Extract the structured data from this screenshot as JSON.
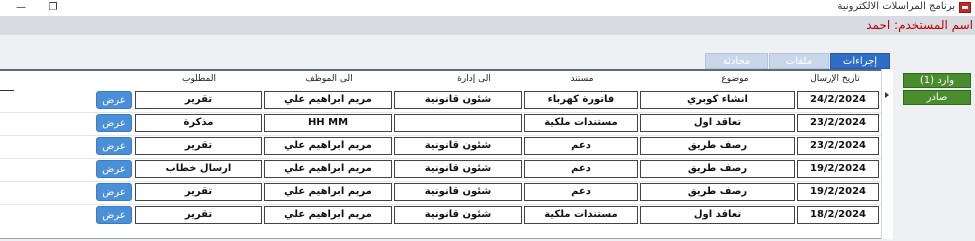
{
  "window": {
    "title": "برنامج المراسلات الالكترونية",
    "minimize_glyph": "—",
    "maximize_glyph": "❐"
  },
  "user": {
    "label": "اسم المستخدم: احمد"
  },
  "tabs": [
    {
      "label": "إجراءات",
      "active": true
    },
    {
      "label": "ملفات",
      "active": false
    },
    {
      "label": "محادثة",
      "active": false
    }
  ],
  "sidenav": {
    "inbox": "وارد (1)",
    "outbox": "صادر"
  },
  "table": {
    "headers": {
      "date": "تاريخ الإرسال",
      "subject": "موضوع",
      "document": "مستند",
      "to_department": "الى إدارة",
      "to_employee": "الى الموظف",
      "required": "المطلوب"
    },
    "view_label": "عرض",
    "rows": [
      {
        "date": "24/2/2024",
        "subject": "انشاء كوبري",
        "document": "فاتورة كهرباء",
        "to_department": "شئون قانونية",
        "to_employee": "مريم ابراهيم علي",
        "required": "تقرير"
      },
      {
        "date": "23/2/2024",
        "subject": "تعاقد اول",
        "document": "مستندات ملكية",
        "to_department": "",
        "to_employee": "HH MM",
        "required": "مذكرة"
      },
      {
        "date": "23/2/2024",
        "subject": "رصف طريق",
        "document": "دعم",
        "to_department": "شئون قانونية",
        "to_employee": "مريم ابراهيم علي",
        "required": "تقرير"
      },
      {
        "date": "19/2/2024",
        "subject": "رصف طريق",
        "document": "دعم",
        "to_department": "شئون قانونية",
        "to_employee": "مريم ابراهيم علي",
        "required": "ارسال خطاب"
      },
      {
        "date": "19/2/2024",
        "subject": "رصف طريق",
        "document": "دعم",
        "to_department": "شئون قانونية",
        "to_employee": "مريم ابراهيم علي",
        "required": "تقرير"
      },
      {
        "date": "18/2/2024",
        "subject": "تعاقد اول",
        "document": "مستندات ملكية",
        "to_department": "شئون قانونية",
        "to_employee": "مريم ابراهيم علي",
        "required": "تقرير"
      }
    ]
  }
}
